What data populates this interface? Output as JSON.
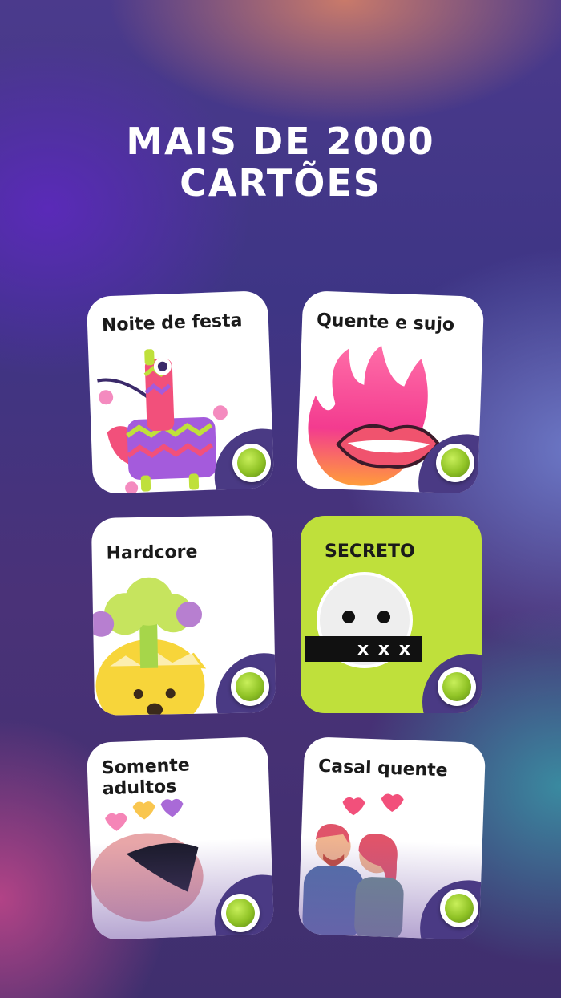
{
  "header": {
    "title_line1": "MAIS DE 2000",
    "title_line2": "CARTÕES"
  },
  "cards": [
    {
      "label": "Noite de festa",
      "icon": "pinata-icon",
      "selected": true
    },
    {
      "label": "Quente e sujo",
      "icon": "fire-lips-icon",
      "selected": true
    },
    {
      "label": "Hardcore",
      "icon": "exploding-head-icon",
      "selected": true
    },
    {
      "label": "SECRETO",
      "icon": "secret-face-icon",
      "selected": true,
      "censor_text": "x x x"
    },
    {
      "label": "Somente adultos",
      "icon": "adult-hearts-icon",
      "selected": true
    },
    {
      "label": "Casal quente",
      "icon": "couple-icon",
      "selected": true
    }
  ],
  "colors": {
    "accent_green": "#bfe03b",
    "toggle_green": "#8fc225",
    "card_white": "#ffffff"
  }
}
